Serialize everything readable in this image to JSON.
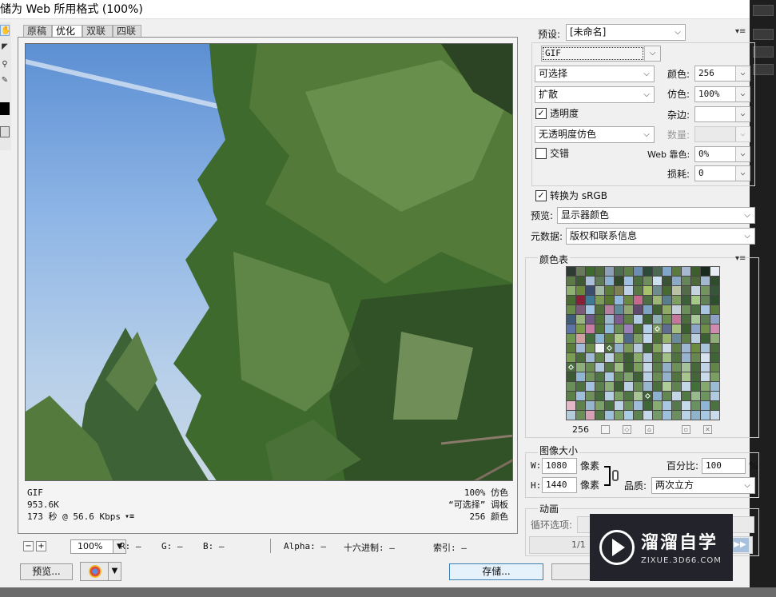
{
  "window": {
    "title": "储为 Web 所用格式 (100%)"
  },
  "tabs": [
    "原稿",
    "优化",
    "双联",
    "四联"
  ],
  "active_tab": 1,
  "tools": [
    "hand-tool",
    "slice-select-tool",
    "zoom-tool",
    "eyedropper-tool",
    "eyedropper-color",
    "toggle-slices"
  ],
  "image_info": {
    "format": "GIF",
    "size": "953.6K",
    "download": "173 秒 @ 56.6 Kbps",
    "dither": "100% 仿色",
    "palette": "“可选择” 调板",
    "colors": "256 颜色"
  },
  "statusbar": {
    "minus": "−",
    "plus": "+",
    "zoom": "100%",
    "r": "R: —",
    "g": "G: —",
    "b": "B: —",
    "alpha": "Alpha: —",
    "hex": "十六进制: —",
    "index": "索引: —"
  },
  "buttons": {
    "preview": "预览...",
    "save": "存储..."
  },
  "settings": {
    "preset_label": "预设:",
    "preset_value": "[未命名]",
    "format": "GIF",
    "reduction": "可选择",
    "dither_algo": "扩散",
    "transparency_checked": true,
    "transparency": "透明度",
    "transparency_dither": "无透明度仿色",
    "interlaced_checked": false,
    "interlaced": "交错",
    "colors_label": "颜色:",
    "colors_value": "256",
    "dither_label": "仿色:",
    "dither_value": "100%",
    "matte_label": "杂边:",
    "matte_value": "",
    "amount_label": "数量:",
    "amount_value": "",
    "websnap_label": "Web 靠色:",
    "websnap_value": "0%",
    "lossy_label": "损耗:",
    "lossy_value": "0",
    "convert_checked": true,
    "convert_srgb": "转换为 sRGB",
    "preview_label": "预览:",
    "preview_value": "显示器颜色",
    "metadata_label": "元数据:",
    "metadata_value": "版权和联系信息"
  },
  "color_table": {
    "title": "颜色表",
    "count": "256",
    "swatches": [
      "#2d3b33",
      "#697a5b",
      "#3d6b2c",
      "#4f6b3e",
      "#8ea0b6",
      "#4e6d4f",
      "#5e7f47",
      "#6a8fb0",
      "#2c4a38",
      "#4c6a53",
      "#7ea7c9",
      "#5a7a3f",
      "#a6b9d1",
      "#3d5f2b",
      "#1b2a1f",
      "#e8eef5",
      "#5b7a46",
      "#3e5a33",
      "#a9c0d8",
      "#5f7a56",
      "#8cb0d0",
      "#31472c",
      "#9ec0e0",
      "#4a6e3b",
      "#6f8e5d",
      "#cde0f0",
      "#3a5236",
      "#8aa9c6",
      "#66855a",
      "#4d6939",
      "#a1b8ce",
      "#2f4d2c",
      "#8fb16f",
      "#6b8a3e",
      "#3a4d6e",
      "#a3b9a8",
      "#5c7d3a",
      "#7f7f54",
      "#bdd1e6",
      "#587844",
      "#a6c26a",
      "#6d8c8e",
      "#486a31",
      "#b9c3a4",
      "#536b48",
      "#c5d5e0",
      "#73935f",
      "#36563a",
      "#4a6d34",
      "#8a1f3a",
      "#3d7a96",
      "#7b9b56",
      "#56762f",
      "#90b8dc",
      "#6a8a44",
      "#c46a8a",
      "#4e6f42",
      "#9cb775",
      "#5a7d8b",
      "#7e9f5f",
      "#3c5f3a",
      "#a5c986",
      "#628356",
      "#2d4f2d",
      "#6a8c4a",
      "#7c5b7a",
      "#a0c4e4",
      "#4d6e3a",
      "#b57fa0",
      "#5f8a9a",
      "#90a570",
      "#5d4a6c",
      "#7aa3c4",
      "#3f6030",
      "#8eaa64",
      "#c5cfd8",
      "#6b8e5a",
      "#4a7040",
      "#a8c6e0",
      "#587a3c",
      "#3f5d7a",
      "#97b67c",
      "#6e5a84",
      "#4e7138",
      "#9bb8ce",
      "#7b5c8f",
      "#5c7f44",
      "#b0cbe2",
      "#3e6133",
      "#8fb0b5",
      "#6b8d4e",
      "#c5779b",
      "#4c6d3e",
      "#a9c89a",
      "#5b7c50",
      "#8ea2c6",
      "#5c74a6",
      "#7a9c49",
      "#c87ca3",
      "#4f7337",
      "#8fb9d8",
      "#6a8c56",
      "#9a7fb8",
      "#4a6c32",
      "#b3d0e8",
      "#7a9b5e",
      "#5f6d90",
      "#a5c17d",
      "#3c5d2f",
      "#8da6c8",
      "#6f8f48",
      "#d18bb0",
      "#6e9850",
      "#d0a0a0",
      "#3f6d3a",
      "#87b5d1",
      "#5a7c40",
      "#aecb8a",
      "#4e6a88",
      "#7e9f64",
      "#c3d8ea",
      "#4d7036",
      "#98b56e",
      "#6a8b9c",
      "#5c7d46",
      "#b9cfe0",
      "#3b5f30",
      "#8fae78",
      "#5a7d3d",
      "#a3bad8",
      "#6c8e4a",
      "#eef3f8",
      "#4e7040",
      "#92b2cb",
      "#7a9a58",
      "#b5c9da",
      "#3e6235",
      "#84a65e",
      "#cfdde9",
      "#5d7f45",
      "#9cb7cf",
      "#6b8c3f",
      "#a8c4db",
      "#486a38",
      "#7a9d54",
      "#4b6d3a",
      "#9fbad2",
      "#5f8247",
      "#c0d3e5",
      "#6e8f4e",
      "#3c5e33",
      "#8aac6a",
      "#b6cbe0",
      "#557840",
      "#a1c286",
      "#4f7340",
      "#98b4cc",
      "#668850",
      "#d6e3ee",
      "#3f6438",
      "#4b6e3f",
      "#8db07a",
      "#6a8d52",
      "#b1c8dd",
      "#547744",
      "#9fbe83",
      "#3d6033",
      "#7c9e5f",
      "#c6d8e8",
      "#5a7c48",
      "#91b0c8",
      "#6e9157",
      "#a5c29a",
      "#48693a",
      "#bfd4e6",
      "#62854a",
      "#3b5a33",
      "#8fb6d2",
      "#6f935a",
      "#4d7442",
      "#a9c8e0",
      "#5f824a",
      "#7ea26b",
      "#3f6136",
      "#b9d0e2",
      "#6a8d55",
      "#94b3c9",
      "#52743f",
      "#a7c58c",
      "#446638",
      "#c9dbe9",
      "#7b9e63",
      "#6b8f59",
      "#4e7341",
      "#a3c2db",
      "#5c804c",
      "#8aae75",
      "#3b5d32",
      "#bad0e3",
      "#688c53",
      "#98b7cf",
      "#4b6e3d",
      "#aecc96",
      "#5f8350",
      "#c4d7e7",
      "#417039",
      "#85a86d",
      "#9bbcd5",
      "#5a7f47",
      "#9ebfd9",
      "#6e9159",
      "#456a3a",
      "#b7cfe3",
      "#7aa065",
      "#4f7543",
      "#a6c593",
      "#3e6135",
      "#8db2cf",
      "#628752",
      "#c2d6e6",
      "#527844",
      "#97b98b",
      "#6d9560",
      "#b0cbe0",
      "#e4b8c6",
      "#5e8249",
      "#98b6cb",
      "#7ca268",
      "#4a6f3f",
      "#bfd3e4",
      "#6b905a",
      "#9dbdda",
      "#3f6637",
      "#87ac72",
      "#a9c7e0",
      "#55794a",
      "#c7dae9",
      "#6a9161",
      "#8fb5d6",
      "#4c7242",
      "#b3ccd9",
      "#6a8f58",
      "#d5a2b4",
      "#4f7544",
      "#a0c1dc",
      "#7aa06b",
      "#aacde6",
      "#5c8250",
      "#c5d9ea",
      "#74996a",
      "#9cc0dc",
      "#6c8f60",
      "#b8d2e6",
      "#8fb3cc",
      "#a7c8e2",
      "#c9dcec"
    ],
    "marked": [
      105,
      132,
      160,
      216
    ]
  },
  "image_size": {
    "title": "图像大小",
    "w_label": "W:",
    "w_value": "1080",
    "h_label": "H:",
    "h_value": "1440",
    "unit": "像素",
    "percent_label": "百分比:",
    "percent_value": "100",
    "percent_unit": "%",
    "quality_label": "品质:",
    "quality_value": "两次立方"
  },
  "animation": {
    "title": "动画",
    "loop_label": "循环选项:",
    "frame": "1/1"
  },
  "watermark": {
    "line1": "溜溜自学",
    "line2": "ZIXUE.3D66.COM"
  }
}
